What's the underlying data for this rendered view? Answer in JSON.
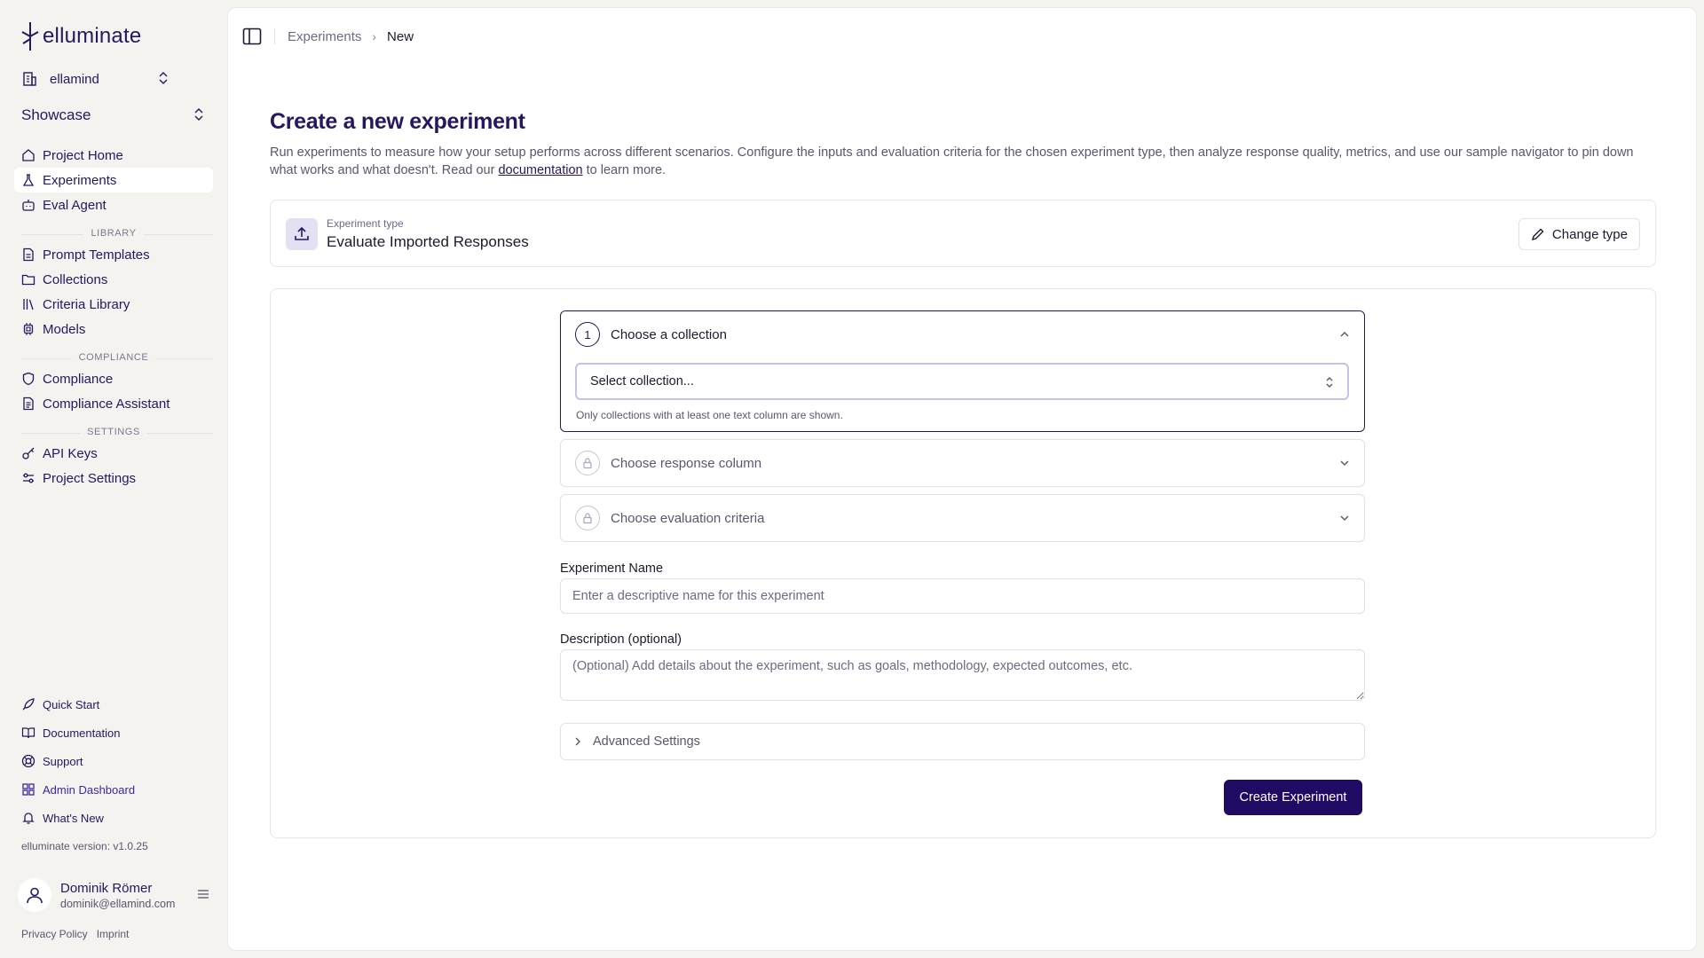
{
  "app": {
    "logo_text": "elluminate",
    "version_text": "elluminate version: v1.0.25"
  },
  "org": {
    "name": "ellamind"
  },
  "project": {
    "name": "Showcase"
  },
  "nav": {
    "main": [
      {
        "label": "Project Home",
        "icon": "home-icon"
      },
      {
        "label": "Experiments",
        "icon": "flask-icon",
        "active": true
      },
      {
        "label": "Eval Agent",
        "icon": "bot-icon"
      }
    ],
    "library_title": "LIBRARY",
    "library": [
      {
        "label": "Prompt Templates",
        "icon": "file-icon"
      },
      {
        "label": "Collections",
        "icon": "folder-icon"
      },
      {
        "label": "Criteria Library",
        "icon": "library-icon"
      },
      {
        "label": "Models",
        "icon": "cpu-icon"
      }
    ],
    "compliance_title": "COMPLIANCE",
    "compliance": [
      {
        "label": "Compliance",
        "icon": "shield-icon"
      },
      {
        "label": "Compliance Assistant",
        "icon": "document-icon"
      }
    ],
    "settings_title": "SETTINGS",
    "settings": [
      {
        "label": "API Keys",
        "icon": "key-icon"
      },
      {
        "label": "Project Settings",
        "icon": "sliders-icon"
      }
    ]
  },
  "footer_nav": [
    {
      "label": "Quick Start",
      "icon": "rocket-icon"
    },
    {
      "label": "Documentation",
      "icon": "book-icon"
    },
    {
      "label": "Support",
      "icon": "lifebuoy-icon"
    },
    {
      "label": "Admin Dashboard",
      "icon": "grid-icon"
    },
    {
      "label": "What's New",
      "icon": "bell-icon"
    }
  ],
  "user": {
    "name": "Dominik Römer",
    "email": "dominik@ellamind.com"
  },
  "legal": {
    "privacy": "Privacy Policy",
    "imprint": "Imprint"
  },
  "breadcrumb": {
    "parent": "Experiments",
    "current": "New"
  },
  "page": {
    "title": "Create a new experiment",
    "desc_before": "Run experiments to measure how your setup performs across different scenarios. Configure the inputs and evaluation criteria for the chosen experiment type, then analyze response quality, metrics, and use our sample navigator to pin down what works and what doesn't. Read our ",
    "desc_link": "documentation",
    "desc_after": " to learn more."
  },
  "experiment_type": {
    "label": "Experiment type",
    "value": "Evaluate Imported Responses",
    "change_button": "Change type"
  },
  "steps": [
    {
      "number": "1",
      "title": "Choose a collection",
      "state": "open",
      "select_placeholder": "Select collection...",
      "hint": "Only collections with at least one text column are shown."
    },
    {
      "title": "Choose response column",
      "state": "locked"
    },
    {
      "title": "Choose evaluation criteria",
      "state": "locked"
    }
  ],
  "form": {
    "name_label": "Experiment Name",
    "name_placeholder": "Enter a descriptive name for this experiment",
    "name_value": "",
    "desc_label": "Description (optional)",
    "desc_placeholder": "(Optional) Add details about the experiment, such as goals, methodology, expected outcomes, etc.",
    "desc_value": "",
    "advanced_label": "Advanced Settings",
    "submit_label": "Create Experiment"
  },
  "colors": {
    "brand": "#27175f",
    "primary_button": "#1f0a64",
    "select_focus": "#c8c0ec"
  }
}
